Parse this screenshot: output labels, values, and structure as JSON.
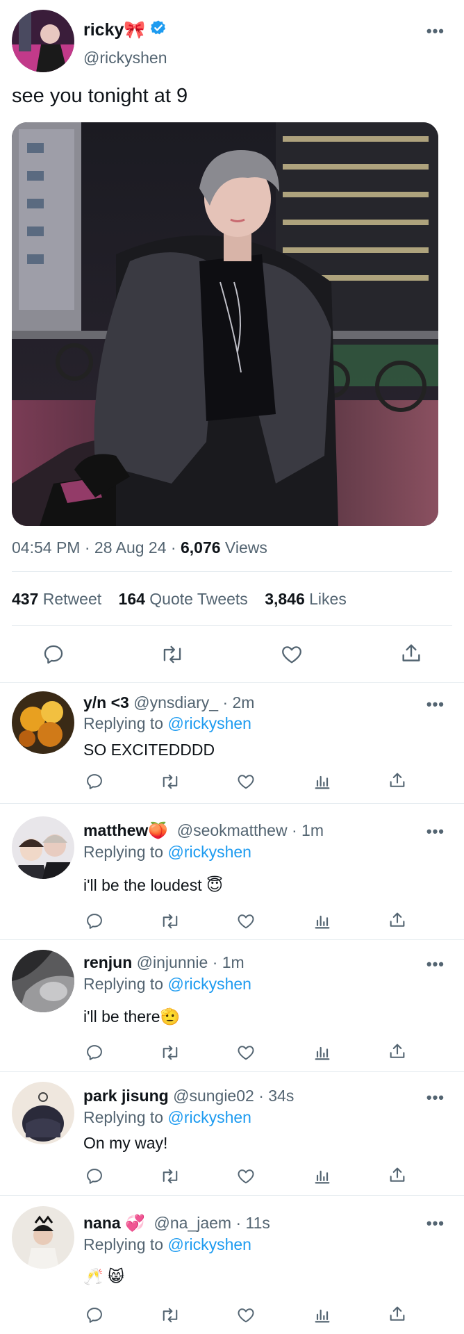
{
  "tweet": {
    "display_name": "ricky🎀",
    "handle": "@rickyshen",
    "text": "see you tonight at 9",
    "time": "04:54 PM",
    "date": "28 Aug 24",
    "views_count": "6,076",
    "views_label": "Views",
    "retweets_count": "437",
    "retweets_label": "Retweet",
    "quotes_count": "164",
    "quotes_label": "Quote Tweets",
    "likes_count": "3,846",
    "likes_label": "Likes",
    "more": "•••",
    "sep": "·"
  },
  "replies": [
    {
      "display_name": "y/n <3",
      "handle": "@ynsdiary_",
      "age": "2m",
      "replying_prefix": "Replying to",
      "replying_to": "@rickyshen",
      "text": "SO EXCITEDDDD"
    },
    {
      "display_name": "matthew🍑",
      "handle": "@seokmatthew",
      "age": "1m",
      "replying_prefix": "Replying to",
      "replying_to": "@rickyshen",
      "text": "i'll be the loudest 😇"
    },
    {
      "display_name": "renjun",
      "handle": "@injunnie",
      "age": "1m",
      "replying_prefix": "Replying to",
      "replying_to": "@rickyshen",
      "text": "i'll be there🫡"
    },
    {
      "display_name": "park jisung",
      "handle": "@sungie02",
      "age": "34s",
      "replying_prefix": "Replying to",
      "replying_to": "@rickyshen",
      "text": "On my way!"
    },
    {
      "display_name": "nana 💞",
      "handle": "@na_jaem",
      "age": "11s",
      "replying_prefix": "Replying to",
      "replying_to": "@rickyshen",
      "text": "🥂 😸"
    }
  ],
  "colors": {
    "accent": "#1d9bf0",
    "secondary_text": "#536471",
    "divider": "#e6ecf0"
  },
  "icons": [
    "reply-icon",
    "retweet-icon",
    "like-icon",
    "views-icon",
    "share-icon",
    "verified-icon",
    "more-icon"
  ]
}
